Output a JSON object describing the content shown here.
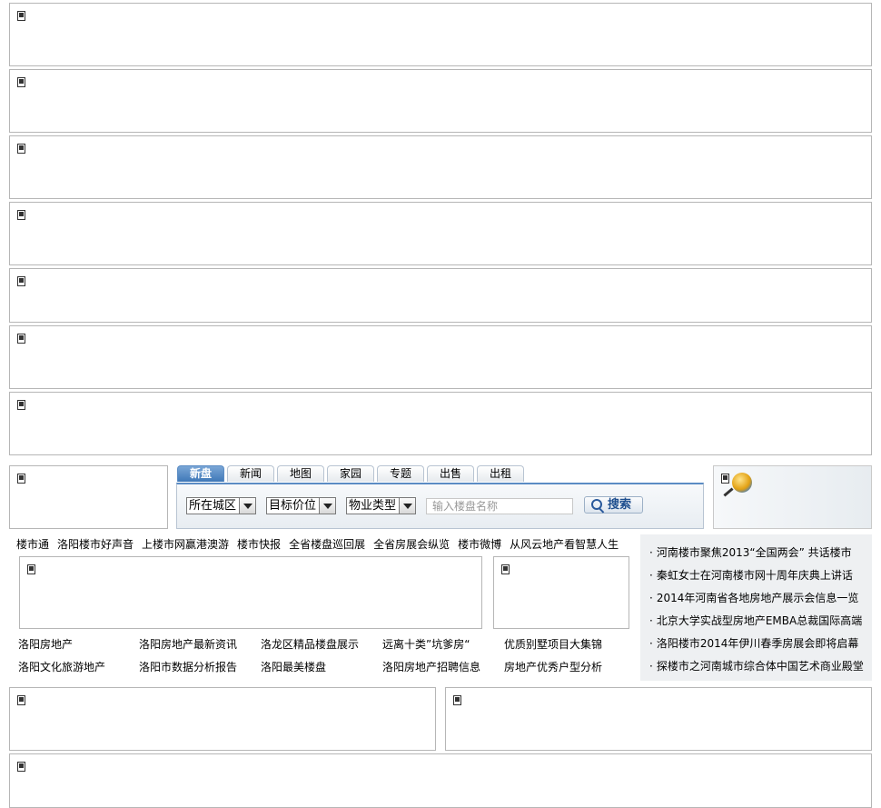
{
  "search": {
    "tabs": [
      "新盘",
      "新闻",
      "地图",
      "家园",
      "专题",
      "出售",
      "出租"
    ],
    "active_tab": "新盘",
    "district_select": "所在城区",
    "price_select": "目标价位",
    "type_select": "物业类型",
    "keyword_placeholder": "输入楼盘名称",
    "search_button": "搜索"
  },
  "nav": [
    "楼市通",
    "洛阳楼市好声音",
    "上楼市网赢港澳游",
    "楼市快报",
    "全省楼盘巡回展",
    "全省房展会纵览",
    "楼市微博",
    "从风云地产看智慧人生"
  ],
  "links": [
    [
      "洛阳房地产",
      "洛阳房地产最新资讯",
      "洛龙区精品楼盘展示",
      "远离十类”坑爹房“",
      "优质别墅项目大集锦"
    ],
    [
      "洛阳文化旅游地产",
      "洛阳市数据分析报告",
      "洛阳最美楼盘",
      "洛阳房地产招聘信息",
      "房地产优秀户型分析"
    ]
  ],
  "news": [
    "河南楼市聚焦2013“全国两会” 共话楼市",
    "秦虹女士在河南楼市网十周年庆典上讲话",
    "2014年河南省各地房地产展示会信息一览",
    "北京大学实战型房地产EMBA总裁国际高端",
    "洛阳楼市2014年伊川春季房展会即将启幕",
    "探楼市之河南城市综合体中国艺术商业殿堂"
  ],
  "colors": {
    "tab_active": "#3f78b8",
    "border": "#b6b6b6",
    "news_bg": "#eef0f2"
  },
  "icons": [
    "placeholder-icon",
    "search-icon",
    "globe-icon",
    "chevron-down-icon"
  ]
}
